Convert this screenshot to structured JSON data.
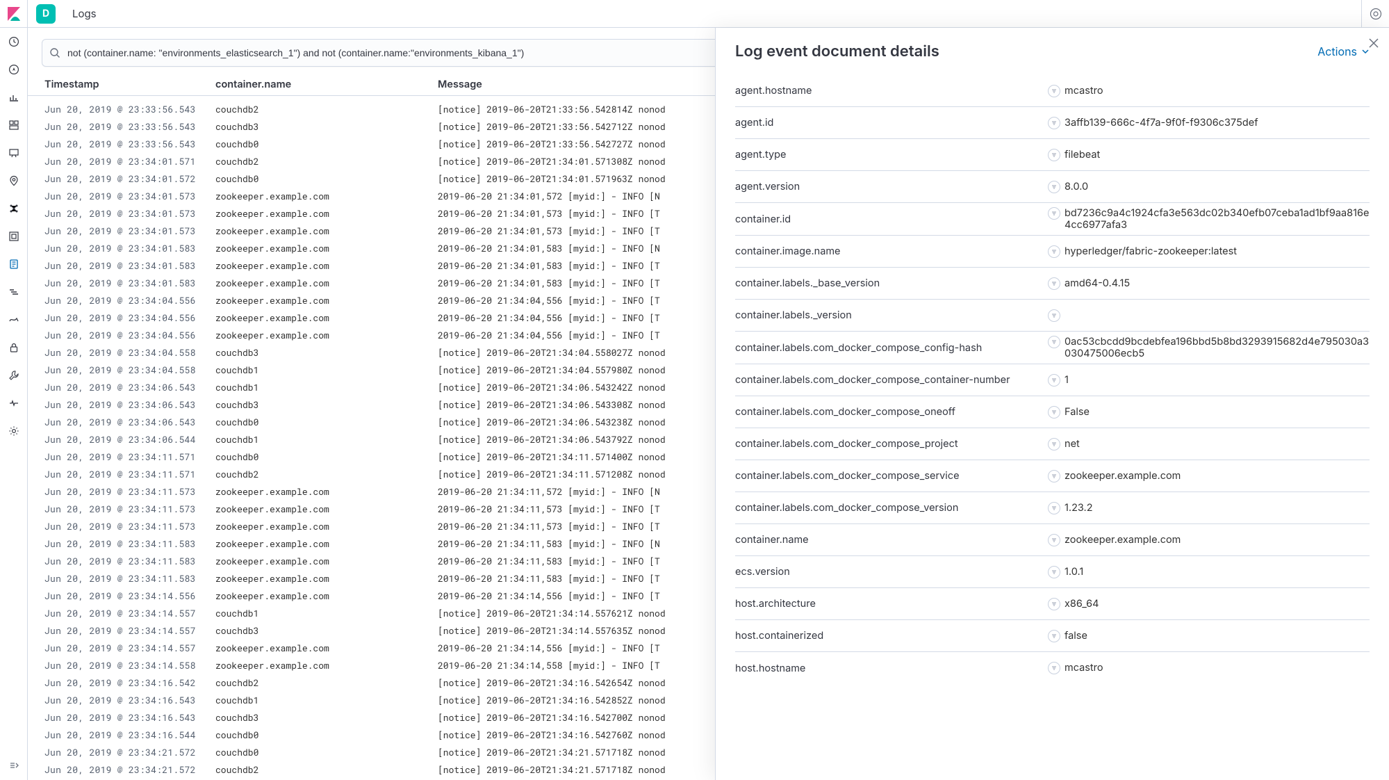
{
  "header": {
    "space_initial": "D",
    "breadcrumb": "Logs"
  },
  "search": {
    "value": "not (container.name: \"environments_elasticsearch_1\") and not (container.name:\"environments_kibana_1\")"
  },
  "columns": {
    "timestamp": "Timestamp",
    "container_name": "container.name",
    "message": "Message"
  },
  "logs": [
    {
      "ts": "Jun 20, 2019 @ 23:33:56.543",
      "name": "couchdb2",
      "msg": "[notice] 2019-06-20T21:33:56.542814Z nonod"
    },
    {
      "ts": "Jun 20, 2019 @ 23:33:56.543",
      "name": "couchdb3",
      "msg": "[notice] 2019-06-20T21:33:56.542712Z nonod"
    },
    {
      "ts": "Jun 20, 2019 @ 23:33:56.543",
      "name": "couchdb0",
      "msg": "[notice] 2019-06-20T21:33:56.542727Z nonod"
    },
    {
      "ts": "Jun 20, 2019 @ 23:34:01.571",
      "name": "couchdb2",
      "msg": "[notice] 2019-06-20T21:34:01.571308Z nonod"
    },
    {
      "ts": "Jun 20, 2019 @ 23:34:01.572",
      "name": "couchdb0",
      "msg": "[notice] 2019-06-20T21:34:01.571963Z nonod"
    },
    {
      "ts": "Jun 20, 2019 @ 23:34:01.573",
      "name": "zookeeper.example.com",
      "msg": "2019-06-20 21:34:01,572 [myid:] - INFO  [N"
    },
    {
      "ts": "Jun 20, 2019 @ 23:34:01.573",
      "name": "zookeeper.example.com",
      "msg": "2019-06-20 21:34:01,573 [myid:] - INFO  [T"
    },
    {
      "ts": "Jun 20, 2019 @ 23:34:01.573",
      "name": "zookeeper.example.com",
      "msg": "2019-06-20 21:34:01,573 [myid:] - INFO  [T"
    },
    {
      "ts": "Jun 20, 2019 @ 23:34:01.583",
      "name": "zookeeper.example.com",
      "msg": "2019-06-20 21:34:01,583 [myid:] - INFO  [N"
    },
    {
      "ts": "Jun 20, 2019 @ 23:34:01.583",
      "name": "zookeeper.example.com",
      "msg": "2019-06-20 21:34:01,583 [myid:] - INFO  [T"
    },
    {
      "ts": "Jun 20, 2019 @ 23:34:01.583",
      "name": "zookeeper.example.com",
      "msg": "2019-06-20 21:34:01,583 [myid:] - INFO  [T"
    },
    {
      "ts": "Jun 20, 2019 @ 23:34:04.556",
      "name": "zookeeper.example.com",
      "msg": "2019-06-20 21:34:04,556 [myid:] - INFO  [T"
    },
    {
      "ts": "Jun 20, 2019 @ 23:34:04.556",
      "name": "zookeeper.example.com",
      "msg": "2019-06-20 21:34:04,556 [myid:] - INFO  [T"
    },
    {
      "ts": "Jun 20, 2019 @ 23:34:04.556",
      "name": "zookeeper.example.com",
      "msg": "2019-06-20 21:34:04,556 [myid:] - INFO  [T"
    },
    {
      "ts": "Jun 20, 2019 @ 23:34:04.558",
      "name": "couchdb3",
      "msg": "[notice] 2019-06-20T21:34:04.558027Z nonod"
    },
    {
      "ts": "Jun 20, 2019 @ 23:34:04.558",
      "name": "couchdb1",
      "msg": "[notice] 2019-06-20T21:34:04.557980Z nonod"
    },
    {
      "ts": "Jun 20, 2019 @ 23:34:06.543",
      "name": "couchdb1",
      "msg": "[notice] 2019-06-20T21:34:06.543242Z nonod"
    },
    {
      "ts": "Jun 20, 2019 @ 23:34:06.543",
      "name": "couchdb3",
      "msg": "[notice] 2019-06-20T21:34:06.543308Z nonod"
    },
    {
      "ts": "Jun 20, 2019 @ 23:34:06.543",
      "name": "couchdb0",
      "msg": "[notice] 2019-06-20T21:34:06.543238Z nonod"
    },
    {
      "ts": "Jun 20, 2019 @ 23:34:06.544",
      "name": "couchdb1",
      "msg": "[notice] 2019-06-20T21:34:06.543792Z nonod"
    },
    {
      "ts": "Jun 20, 2019 @ 23:34:11.571",
      "name": "couchdb0",
      "msg": "[notice] 2019-06-20T21:34:11.571400Z nonod"
    },
    {
      "ts": "Jun 20, 2019 @ 23:34:11.571",
      "name": "couchdb2",
      "msg": "[notice] 2019-06-20T21:34:11.571208Z nonod"
    },
    {
      "ts": "Jun 20, 2019 @ 23:34:11.573",
      "name": "zookeeper.example.com",
      "msg": "2019-06-20 21:34:11,572 [myid:] - INFO  [N"
    },
    {
      "ts": "Jun 20, 2019 @ 23:34:11.573",
      "name": "zookeeper.example.com",
      "msg": "2019-06-20 21:34:11,573 [myid:] - INFO  [T"
    },
    {
      "ts": "Jun 20, 2019 @ 23:34:11.573",
      "name": "zookeeper.example.com",
      "msg": "2019-06-20 21:34:11,573 [myid:] - INFO  [T"
    },
    {
      "ts": "Jun 20, 2019 @ 23:34:11.583",
      "name": "zookeeper.example.com",
      "msg": "2019-06-20 21:34:11,583 [myid:] - INFO  [N"
    },
    {
      "ts": "Jun 20, 2019 @ 23:34:11.583",
      "name": "zookeeper.example.com",
      "msg": "2019-06-20 21:34:11,583 [myid:] - INFO  [T"
    },
    {
      "ts": "Jun 20, 2019 @ 23:34:11.583",
      "name": "zookeeper.example.com",
      "msg": "2019-06-20 21:34:11,583 [myid:] - INFO  [T"
    },
    {
      "ts": "Jun 20, 2019 @ 23:34:14.556",
      "name": "zookeeper.example.com",
      "msg": "2019-06-20 21:34:14,556 [myid:] - INFO  [T"
    },
    {
      "ts": "Jun 20, 2019 @ 23:34:14.557",
      "name": "couchdb1",
      "msg": "[notice] 2019-06-20T21:34:14.557621Z nonod"
    },
    {
      "ts": "Jun 20, 2019 @ 23:34:14.557",
      "name": "couchdb3",
      "msg": "[notice] 2019-06-20T21:34:14.557635Z nonod"
    },
    {
      "ts": "Jun 20, 2019 @ 23:34:14.557",
      "name": "zookeeper.example.com",
      "msg": "2019-06-20 21:34:14,556 [myid:] - INFO  [T"
    },
    {
      "ts": "Jun 20, 2019 @ 23:34:14.558",
      "name": "zookeeper.example.com",
      "msg": "2019-06-20 21:34:14,558 [myid:] - INFO  [T"
    },
    {
      "ts": "Jun 20, 2019 @ 23:34:16.542",
      "name": "couchdb2",
      "msg": "[notice] 2019-06-20T21:34:16.542654Z nonod"
    },
    {
      "ts": "Jun 20, 2019 @ 23:34:16.543",
      "name": "couchdb1",
      "msg": "[notice] 2019-06-20T21:34:16.542852Z nonod"
    },
    {
      "ts": "Jun 20, 2019 @ 23:34:16.543",
      "name": "couchdb3",
      "msg": "[notice] 2019-06-20T21:34:16.542700Z nonod"
    },
    {
      "ts": "Jun 20, 2019 @ 23:34:16.544",
      "name": "couchdb0",
      "msg": "[notice] 2019-06-20T21:34:16.542760Z nonod"
    },
    {
      "ts": "Jun 20, 2019 @ 23:34:21.572",
      "name": "couchdb0",
      "msg": "[notice] 2019-06-20T21:34:21.571718Z nonod"
    },
    {
      "ts": "Jun 20, 2019 @ 23:34:21.572",
      "name": "couchdb2",
      "msg": "[notice] 2019-06-20T21:34:21.571718Z nonod"
    }
  ],
  "flyout": {
    "title": "Log event document details",
    "actions_label": "Actions",
    "fields": [
      {
        "label": "agent.hostname",
        "value": "mcastro"
      },
      {
        "label": "agent.id",
        "value": "3affb139-666c-4f7a-9f0f-f9306c375def"
      },
      {
        "label": "agent.type",
        "value": "filebeat"
      },
      {
        "label": "agent.version",
        "value": "8.0.0"
      },
      {
        "label": "container.id",
        "value": "bd7236c9a4c1924cfa3e563dc02b340efb07ceba1ad1bf9aa816e4cc6977afa3"
      },
      {
        "label": "container.image.name",
        "value": "hyperledger/fabric-zookeeper:latest"
      },
      {
        "label": "container.labels._base_version",
        "value": "amd64-0.4.15"
      },
      {
        "label": "container.labels._version",
        "value": ""
      },
      {
        "label": "container.labels.com_docker_compose_config-hash",
        "value": "0ac53cbcdd9bcdebfea196bbd5b8bd3293915682d4e795030a3030475006ecb5"
      },
      {
        "label": "container.labels.com_docker_compose_container-number",
        "value": "1"
      },
      {
        "label": "container.labels.com_docker_compose_oneoff",
        "value": "False"
      },
      {
        "label": "container.labels.com_docker_compose_project",
        "value": "net"
      },
      {
        "label": "container.labels.com_docker_compose_service",
        "value": "zookeeper.example.com"
      },
      {
        "label": "container.labels.com_docker_compose_version",
        "value": "1.23.2"
      },
      {
        "label": "container.name",
        "value": "zookeeper.example.com"
      },
      {
        "label": "ecs.version",
        "value": "1.0.1"
      },
      {
        "label": "host.architecture",
        "value": "x86_64"
      },
      {
        "label": "host.containerized",
        "value": "false"
      },
      {
        "label": "host.hostname",
        "value": "mcastro"
      }
    ]
  },
  "sidebar_icons": [
    "recent",
    "discover",
    "visualize",
    "dashboard",
    "canvas",
    "maps",
    "ml",
    "infra",
    "logs",
    "apm",
    "uptime",
    "siem",
    "dev-tools",
    "monitoring",
    "management"
  ]
}
